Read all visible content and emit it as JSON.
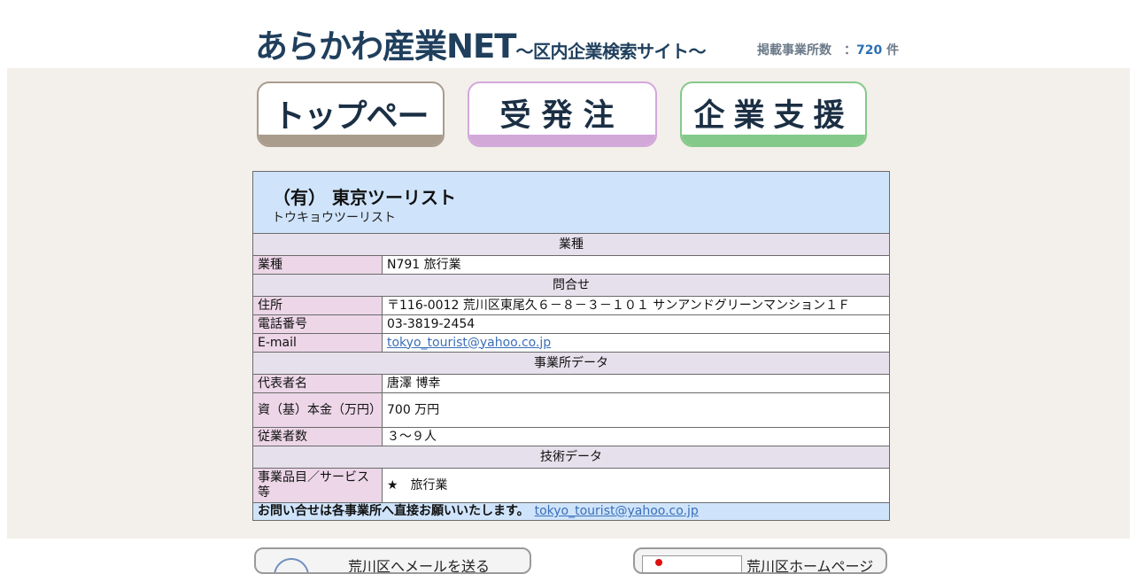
{
  "header": {
    "title_main": "あらかわ産業NET",
    "title_sub": "～区内企業検索サイト～",
    "count_label": "掲載事業所数　：",
    "count_value": "720",
    "count_unit": " 件"
  },
  "nav": {
    "top_label": "トップページ",
    "order_label": "受発注",
    "support_label": "企業支援"
  },
  "company": {
    "name": "（有） 東京ツーリスト",
    "kana": "トウキョウツーリスト"
  },
  "sections": {
    "industry": "業種",
    "contact": "問合せ",
    "office": "事業所データ",
    "tech": "技術データ"
  },
  "rows": {
    "industry_label": "業種",
    "industry_value": "N791 旅行業",
    "address_label": "住所",
    "address_value": "〒116-0012 荒川区東尾久６－８－３－１０１ サンアンドグリーンマンション１Ｆ",
    "phone_label": "電話番号",
    "phone_value": "03-3819-2454",
    "email_label": "E-mail",
    "email_value": "tokyo_tourist@yahoo.co.jp",
    "rep_label": "代表者名",
    "rep_value": "唐澤 博幸",
    "capital_label": "資（基）本金（万円）",
    "capital_value": "700 万円",
    "employees_label": "従業者数",
    "employees_value": "３～９人",
    "products_label": "事業品目／サービス等",
    "products_value": "★　旅行業"
  },
  "footer": {
    "note": "お問い合せは各事業所へ直接お願いいたします。",
    "email": "tokyo_tourist@yahoo.co.jp"
  },
  "bottom": {
    "mail_label": "荒川区へメールを送る",
    "home_label": "荒川区ホームページ"
  }
}
